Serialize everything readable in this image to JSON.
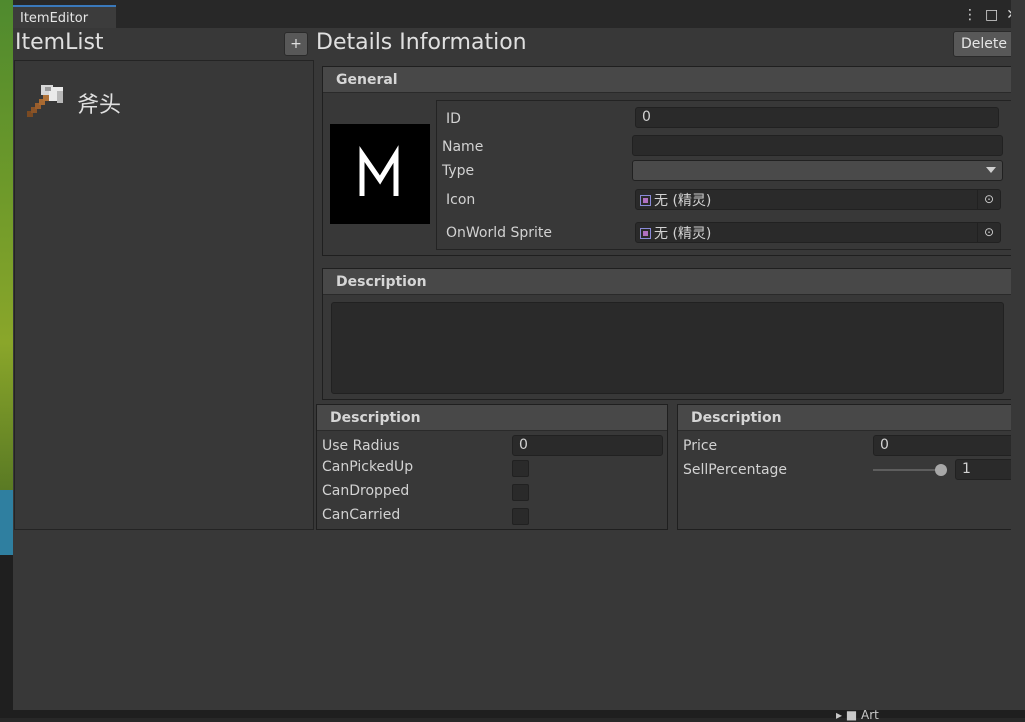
{
  "window": {
    "tab_title": "ItemEditor",
    "menu_icon": "⋮",
    "maximize_icon": "□",
    "close_icon": "✕"
  },
  "left_panel": {
    "title": "ItemList",
    "add_label": "+",
    "items": [
      {
        "label": "斧头",
        "icon": "axe-icon"
      }
    ]
  },
  "right_panel": {
    "title": "Details Information",
    "delete_label": "Delete",
    "general": {
      "header": "General",
      "preview_icon": "rune-icon",
      "id_label": "ID",
      "id_value": "0",
      "name_label": "Name",
      "name_value": "",
      "type_label": "Type",
      "type_value": "",
      "icon_label": "Icon",
      "icon_value": "无 (精灵)",
      "onworld_label": "OnWorld Sprite",
      "onworld_value": "无 (精灵)"
    },
    "description": {
      "header": "Description",
      "value": ""
    },
    "usage": {
      "header": "Description",
      "use_radius_label": "Use Radius",
      "use_radius_value": "0",
      "can_picked_up_label": "CanPickedUp",
      "can_picked_up": false,
      "can_dropped_label": "CanDropped",
      "can_dropped": false,
      "can_carried_label": "CanCarried",
      "can_carried": false
    },
    "pricing": {
      "header": "Description",
      "price_label": "Price",
      "price_value": "0",
      "sell_label": "SellPercentage",
      "sell_value": "1",
      "sell_fraction": 1
    }
  },
  "background": {
    "art_label": "Art"
  },
  "colors": {
    "accent": "#3a79bb",
    "panel": "#383838",
    "field": "#2a2a2a"
  }
}
